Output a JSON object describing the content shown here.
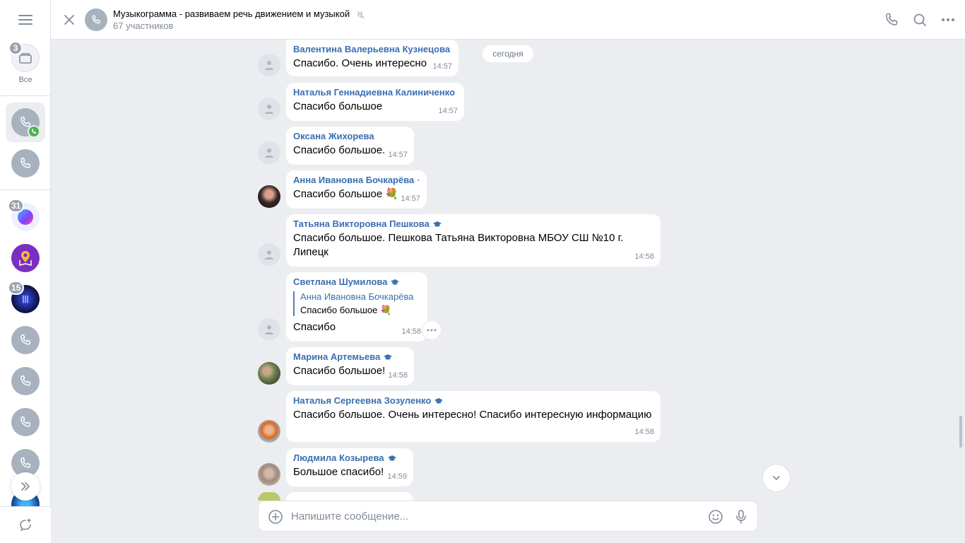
{
  "rail": {
    "folder_badge": "3",
    "folder_label": "Все",
    "badges": {
      "item3": "31",
      "item5": "15"
    }
  },
  "header": {
    "title": "Музыкограмма - развиваем речь движением и музыкой",
    "subtitle": "67 участников"
  },
  "date_separator": "сегодня",
  "messages": [
    {
      "author": "Валентина Валерьевна Кузнецова",
      "text": "Спасибо.  Очень интересно",
      "time": "14:57"
    },
    {
      "author": "Наталья Геннадиевна Калиниченко",
      "text": "Спасибо большое",
      "time": "14:57"
    },
    {
      "author": "Оксана Жихорева",
      "text": "Спасибо большое.",
      "time": "14:57"
    },
    {
      "author": "Анна Ивановна Бочкарёва",
      "text": "Спасибо большое 💐",
      "time": "14:57"
    },
    {
      "author": "Татьяна Викторовна Пешкова",
      "text": "Спасибо большое. Пешкова Татьяна Викторовна МБОУ СШ №10 г. Липецк",
      "time": "14:58"
    },
    {
      "author": "Светлана Шумилова",
      "reply_author": "Анна Ивановна Бочкарёва",
      "reply_text": "Спасибо большое 💐",
      "text": "Спасибо",
      "time": "14:58"
    },
    {
      "author": "Марина Артемьева",
      "text": "Спасибо большое!",
      "time": "14:58"
    },
    {
      "author": "Наталья Сергеевна Зозуленко",
      "text": "Спасибо большое. Очень интересно! Спасибо интересную информацию",
      "time": "14:58"
    },
    {
      "author": "Людмила Козырева",
      "text": "Большое спасибо!",
      "time": "14:59"
    }
  ],
  "composer": {
    "placeholder": "Напишите сообщение..."
  },
  "colors": {
    "accent": "#3a6fb0",
    "background": "#ebedf0",
    "online": "#4bb34b"
  }
}
